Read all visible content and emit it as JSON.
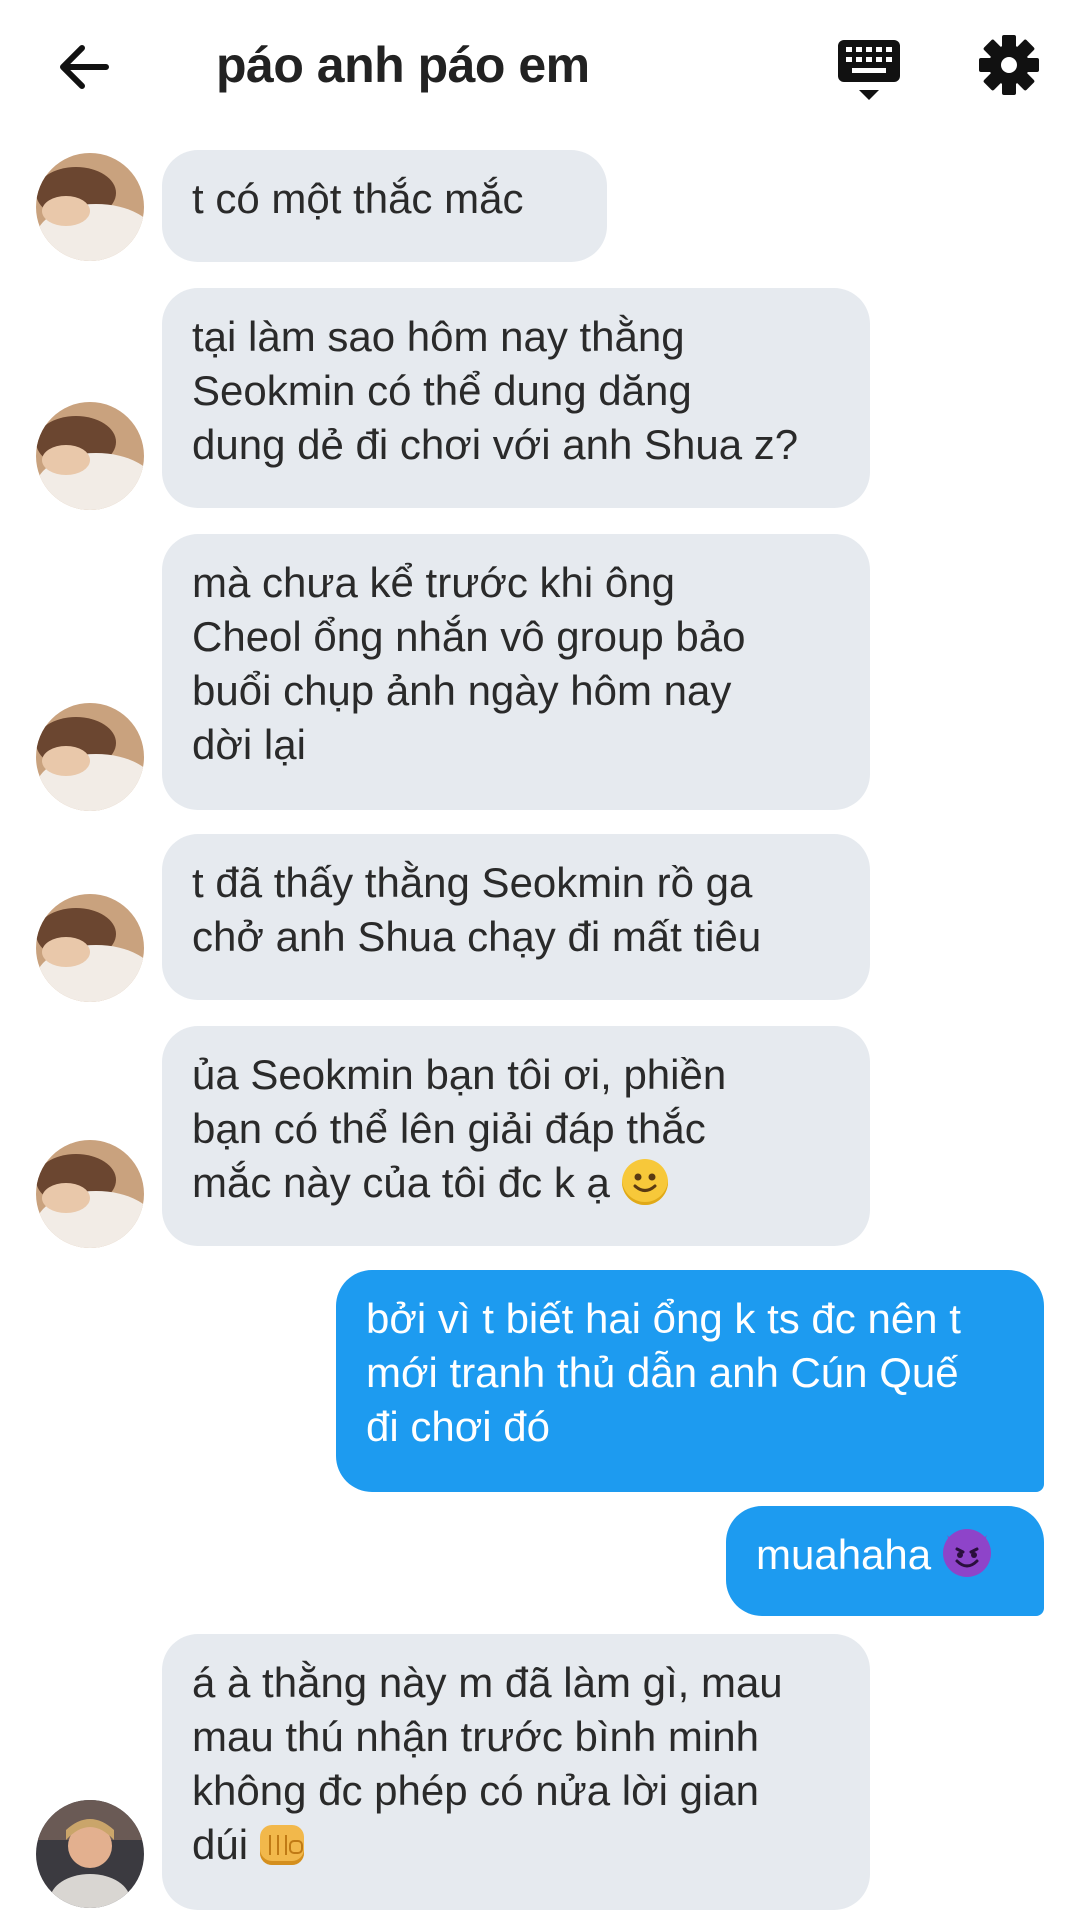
{
  "header": {
    "title": "páo anh páo em",
    "back_icon": "arrow-left-icon",
    "keyboard_icon": "keyboard-icon",
    "settings_icon": "gear-icon"
  },
  "colors": {
    "incoming_bubble": "#e6eaef",
    "outgoing_bubble": "#1d9bf0",
    "text": "#2a2a2a"
  },
  "messages": [
    {
      "side": "in",
      "lines": [
        "t có một thắc mắc"
      ]
    },
    {
      "side": "in",
      "lines": [
        "tại làm sao hôm nay thằng",
        "Seokmin có thể dung dăng",
        "dung dẻ đi chơi với anh Shua z?"
      ]
    },
    {
      "side": "in",
      "lines": [
        "mà chưa kể trước khi ông",
        "Cheol ổng nhắn vô group bảo",
        "buổi chụp ảnh ngày hôm nay",
        "dời lại"
      ]
    },
    {
      "side": "in",
      "lines": [
        "t đã thấy thằng Seokmin rồ ga",
        "chở anh Shua chạy đi mất tiêu"
      ]
    },
    {
      "side": "in",
      "lines": [
        "ủa Seokmin bạn tôi ơi, phiền",
        "bạn có thể lên giải đáp thắc",
        "mắc này của tôi đc k ạ"
      ],
      "emoji": "slightly-smiling-face-emoji"
    },
    {
      "side": "out",
      "lines": [
        "bởi vì t biết hai ổng k ts đc nên t",
        "mới tranh thủ dẫn anh Cún Quế",
        "đi chơi đó"
      ]
    },
    {
      "side": "out",
      "lines": [
        "muahaha"
      ],
      "emoji": "smiling-devil-emoji"
    },
    {
      "side": "in",
      "lines": [
        "á à thằng này m đã làm gì, mau",
        "mau thú nhận trước bình minh",
        "không đc phép có nửa lời gian",
        "dúi"
      ],
      "emoji": "fist-emoji"
    }
  ]
}
